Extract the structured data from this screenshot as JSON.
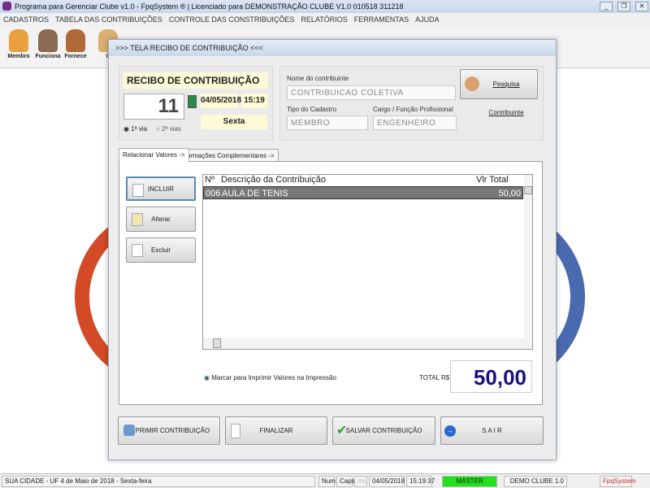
{
  "window": {
    "title": "Programa para Gerenciar Clube v1.0 - FpqSystem ® | Licenciado para  DEMONSTRAÇÃO CLUBE V1.0 010518 311218",
    "min": "_",
    "restore": "❐",
    "close": "✕"
  },
  "menu": [
    "CADASTROS",
    "TABELA DAS CONTRIBUIÇÕES",
    "CONTROLE DAS CONSTRIBUIÇÕES",
    "RELATÓRIOS",
    "FERRAMENTAS",
    "AJUDA"
  ],
  "toolbar": {
    "membro": "Membro",
    "funciona": "Funciona",
    "fornece": "Fornece",
    "c": "C"
  },
  "dialog": {
    "title": ">>>  TELA RECIBO DE CONTRIBUIÇÃO   <<<",
    "receipt_title": "RECIBO DE CONTRIBUIÇÃO",
    "number": "11",
    "date": "04/05/2018",
    "time": "15:19",
    "weekday": "Sexta",
    "via1": "1ª via",
    "via2": "2ª vias",
    "nome_label": "Nome do contribuinte",
    "nome": "CONTRIBUICAO COLETIVA",
    "tipo_label": "Tipo do Cadastro",
    "tipo": "MEMBRO",
    "cargo_label": "Cargo / Função Profissional",
    "cargo": "ENGENHEIRO",
    "pesquisa": "Pesquisa Contribuinte",
    "tabs": [
      "Relacionar Valores ->",
      "Informações Complementares ->"
    ],
    "incluir": "INCLUIR",
    "alterar": "Alterar",
    "excluir": "Excluir",
    "grid": {
      "headers": [
        "Nº",
        "Descrição da Contribuição",
        "Vlr Total"
      ],
      "rows": [
        [
          "006",
          "AULA DE TENIS",
          "50,00"
        ]
      ]
    },
    "marcar": "Marcar para Imprimir Valores na Impressão",
    "total_label": "TOTAL R$",
    "total": "50,00",
    "imprimir": "IMPRIMIR CONTRIBUIÇÃO",
    "finalizar": "FINALIZAR",
    "salvar": "SALVAR CONTRIBUIÇÃO",
    "sair": "S A I R"
  },
  "status": {
    "city": "SUA CIDADE - UF  4 de Maio de 2018 - Sexta-feira",
    "num": "Num",
    "caps": "Caps",
    "ins": "Ins",
    "date": "04/05/2018",
    "time": "15:19:37",
    "user": "MASTER",
    "db": "DEMO CLUBE 1.0",
    "brand": "FpqSystem"
  },
  "colors": {
    "accent_total": "#1a1080",
    "master_green": "#22e01a",
    "selected_row": "#777777"
  }
}
